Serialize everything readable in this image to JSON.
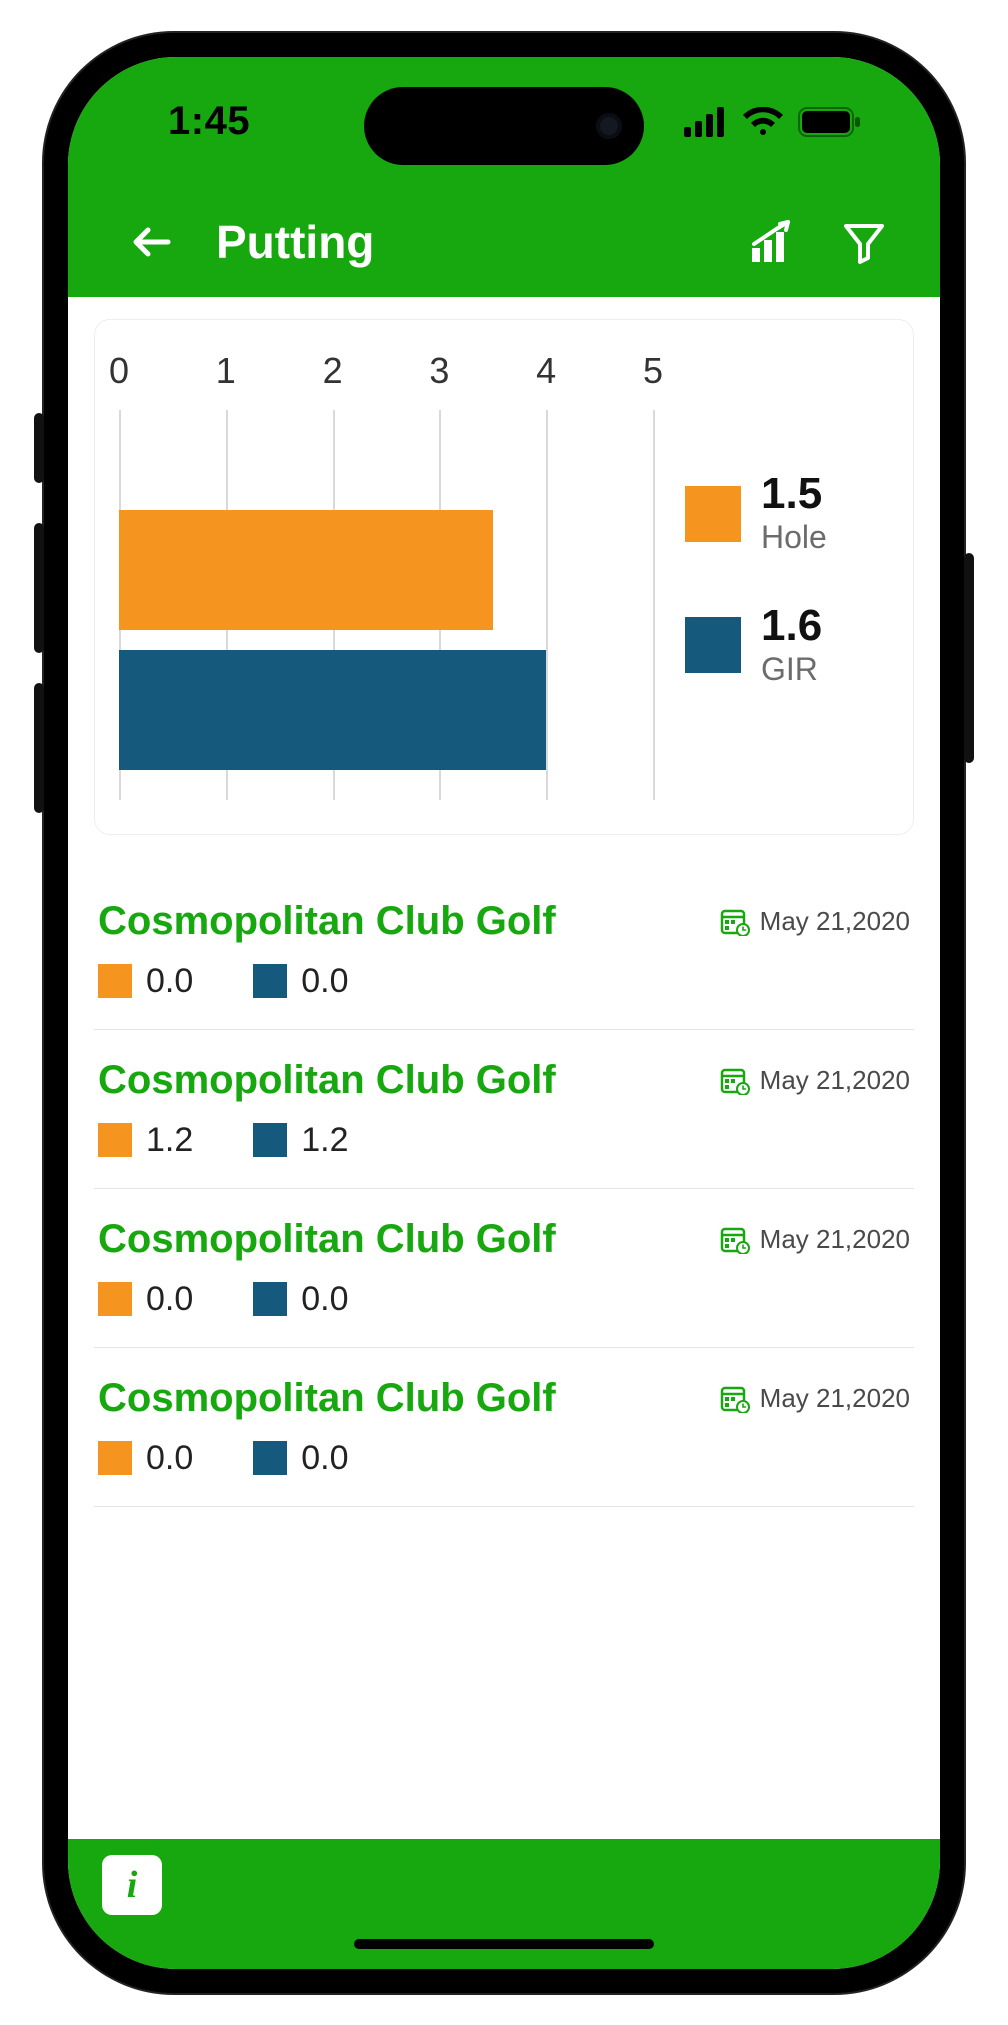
{
  "status": {
    "time": "1:45"
  },
  "header": {
    "title": "Putting"
  },
  "colors": {
    "orange": "#f5941e",
    "navy": "#155a7d",
    "green": "#17a80f"
  },
  "chart_data": {
    "type": "bar",
    "orientation": "horizontal",
    "xlabel": "",
    "ylabel": "",
    "xlim": [
      0,
      5
    ],
    "ticks": [
      0,
      1,
      2,
      3,
      4,
      5
    ],
    "series": [
      {
        "name": "Hole",
        "color": "#f5941e",
        "value": 1.5,
        "bar_extent": 3.5
      },
      {
        "name": "GIR",
        "color": "#155a7d",
        "value": 1.6,
        "bar_extent": 4.0
      }
    ]
  },
  "rounds": [
    {
      "course": "Cosmopolitan Club Golf",
      "date": "May 21,2020",
      "hole": "0.0",
      "gir": "0.0"
    },
    {
      "course": "Cosmopolitan Club Golf",
      "date": "May 21,2020",
      "hole": "1.2",
      "gir": "1.2"
    },
    {
      "course": "Cosmopolitan Club Golf",
      "date": "May 21,2020",
      "hole": "0.0",
      "gir": "0.0"
    },
    {
      "course": "Cosmopolitan Club Golf",
      "date": "May 21,2020",
      "hole": "0.0",
      "gir": "0.0"
    }
  ]
}
